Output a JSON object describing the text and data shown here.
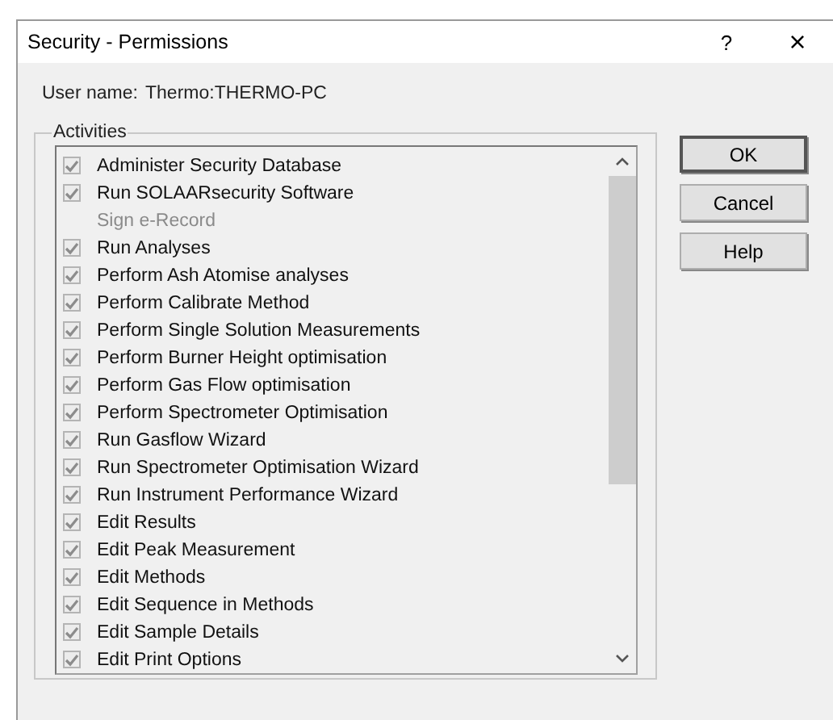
{
  "window": {
    "title": "Security - Permissions",
    "help_glyph": "?",
    "close_glyph": "×"
  },
  "user": {
    "label": "User name:",
    "value": "Thermo:THERMO-PC"
  },
  "activities": {
    "title": "Activities",
    "items": [
      {
        "label": "Administer Security Database",
        "checked": true,
        "available": true
      },
      {
        "label": "Run SOLAARsecurity Software",
        "checked": true,
        "available": true
      },
      {
        "label": "Sign e-Record",
        "available": false
      },
      {
        "label": "Run Analyses",
        "checked": true,
        "available": true
      },
      {
        "label": "Perform Ash Atomise analyses",
        "checked": true,
        "available": true
      },
      {
        "label": "Perform Calibrate Method",
        "checked": true,
        "available": true
      },
      {
        "label": "Perform Single Solution Measurements",
        "checked": true,
        "available": true
      },
      {
        "label": "Perform Burner Height optimisation",
        "checked": true,
        "available": true
      },
      {
        "label": "Perform Gas Flow optimisation",
        "checked": true,
        "available": true
      },
      {
        "label": "Perform Spectrometer Optimisation",
        "checked": true,
        "available": true
      },
      {
        "label": "Run Gasflow Wizard",
        "checked": true,
        "available": true
      },
      {
        "label": "Run Spectrometer Optimisation Wizard",
        "checked": true,
        "available": true
      },
      {
        "label": "Run Instrument Performance Wizard",
        "checked": true,
        "available": true
      },
      {
        "label": "Edit Results",
        "checked": true,
        "available": true
      },
      {
        "label": "Edit Peak Measurement",
        "checked": true,
        "available": true
      },
      {
        "label": "Edit Methods",
        "checked": true,
        "available": true
      },
      {
        "label": "Edit Sequence in Methods",
        "checked": true,
        "available": true
      },
      {
        "label": "Edit Sample Details",
        "checked": true,
        "available": true
      },
      {
        "label": "Edit Print Options",
        "checked": true,
        "available": true
      }
    ]
  },
  "buttons": [
    {
      "label": "OK",
      "default": true
    },
    {
      "label": "Cancel",
      "default": false
    },
    {
      "label": "Help",
      "default": false
    }
  ]
}
